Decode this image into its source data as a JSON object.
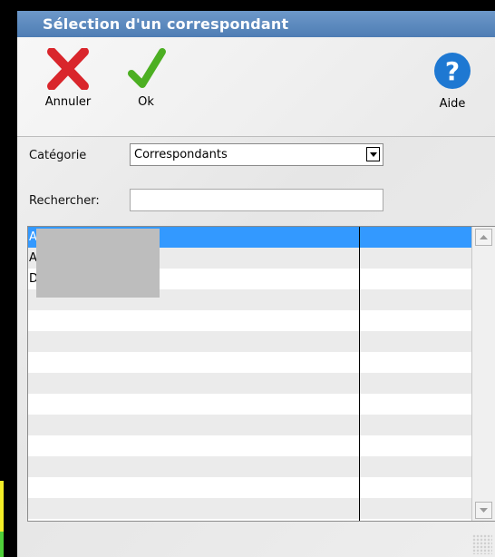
{
  "window": {
    "title": "Sélection d'un correspondant"
  },
  "toolbar": {
    "cancel_label": "Annuler",
    "ok_label": "Ok",
    "help_label": "Aide"
  },
  "form": {
    "category_label": "Catégorie",
    "category_value": "Correspondants",
    "search_label": "Rechercher:",
    "search_value": ""
  },
  "list": {
    "rows": [
      {
        "col1": "A",
        "col2": "",
        "selected": true
      },
      {
        "col1": "A",
        "col2": "",
        "selected": false
      },
      {
        "col1": "D",
        "col2": "",
        "selected": false
      }
    ],
    "selection_color": "#3399ff",
    "alt_row_color": "#ebebeb"
  },
  "colors": {
    "title_bar": "#5a88bf",
    "cancel_icon": "#d9262c",
    "ok_icon": "#4caf22",
    "help_icon": "#1e78d2"
  }
}
